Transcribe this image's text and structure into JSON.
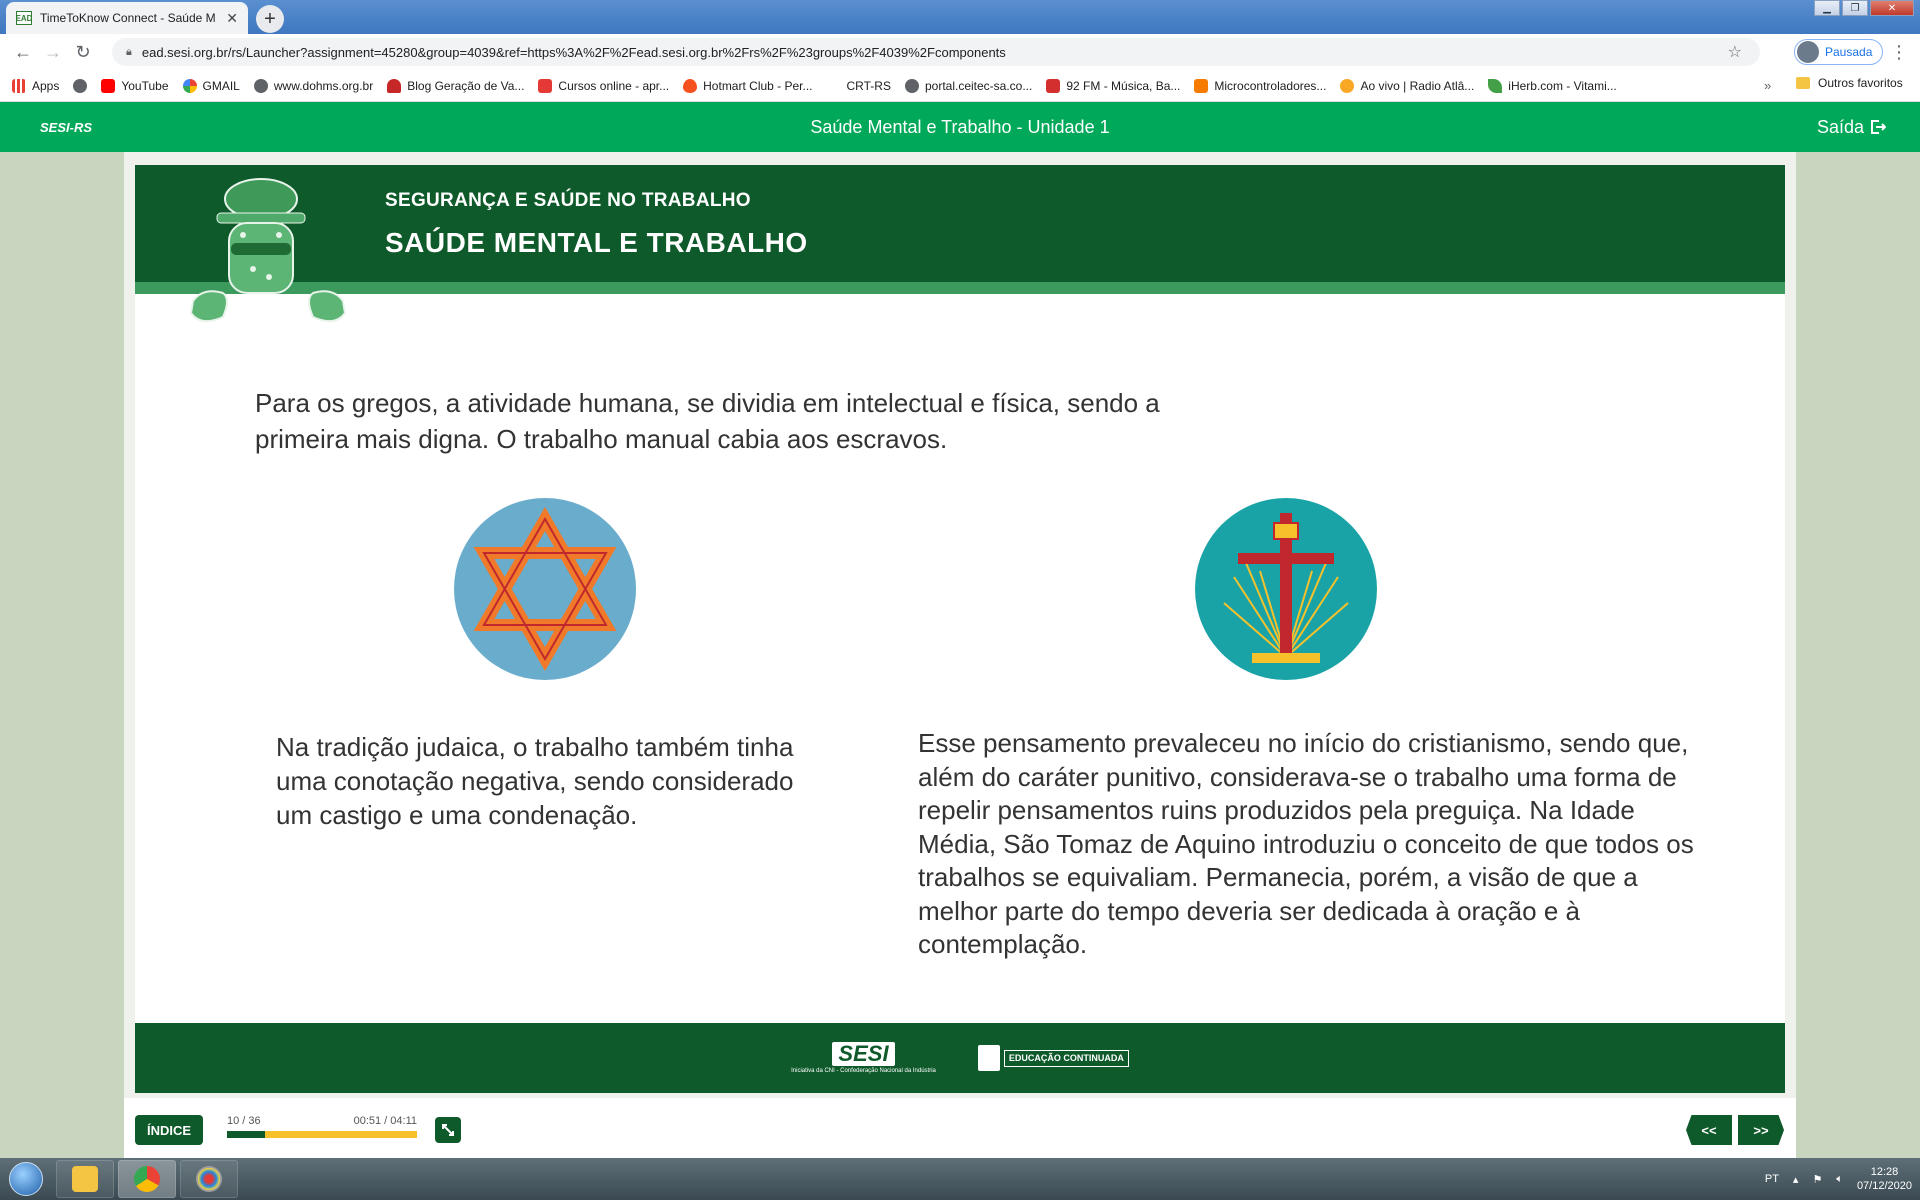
{
  "browser": {
    "tab_title": "TimeToKnow Connect - Saúde M",
    "tab_favicon": "EAD",
    "url": "ead.sesi.org.br/rs/Launcher?assignment=45280&group=4039&ref=https%3A%2F%2Fead.sesi.org.br%2Frs%2F%23groups%2F4039%2Fcomponents",
    "profile_label": "Pausada",
    "bookmarks": [
      {
        "label": "Apps",
        "icon": "apps-grid-icon",
        "color": "#e94235"
      },
      {
        "label": "",
        "icon": "globe-icon",
        "color": "#5f6368"
      },
      {
        "label": "YouTube",
        "icon": "youtube-icon",
        "color": "#ff0000"
      },
      {
        "label": "GMAIL",
        "icon": "google-icon",
        "color": "#4285f4"
      },
      {
        "label": "www.dohms.org.br",
        "icon": "globe-icon",
        "color": "#5f6368"
      },
      {
        "label": "Blog Geração de Va...",
        "icon": "club-icon",
        "color": "#c62828"
      },
      {
        "label": "Cursos online - apr...",
        "icon": "udemy-icon",
        "color": "#e53935"
      },
      {
        "label": "Hotmart Club - Per...",
        "icon": "flame-icon",
        "color": "#f4511e"
      },
      {
        "label": "CRT-RS",
        "icon": "blank-icon",
        "color": "#ffffff"
      },
      {
        "label": "portal.ceitec-sa.co...",
        "icon": "globe-icon",
        "color": "#5f6368"
      },
      {
        "label": "92 FM - Música, Ba...",
        "icon": "radio-92-icon",
        "color": "#d32f2f"
      },
      {
        "label": "Microcontroladores...",
        "icon": "blogger-icon",
        "color": "#f57c00"
      },
      {
        "label": "Ao vivo | Radio Atlâ...",
        "icon": "radio-icon",
        "color": "#f9a825"
      },
      {
        "label": "iHerb.com - Vitami...",
        "icon": "leaf-icon",
        "color": "#43a047"
      }
    ],
    "other_bookmarks": "Outros favoritos",
    "more": "»"
  },
  "app": {
    "brand": "SESI-RS",
    "title": "Saúde Mental e Trabalho - Unidade 1",
    "exit_label": "Saída"
  },
  "slide": {
    "kicker": "SEGURANÇA E SAÚDE NO TRABALHO",
    "heading": "SAÚDE MENTAL E TRABALHO",
    "intro": "Para os gregos, a atividade humana, se dividia em intelectual e física, sendo a primeira mais digna. O trabalho manual cabia aos escravos.",
    "left_text": "Na tradição judaica, o trabalho também tinha uma conotação negativa, sendo considerado um castigo e uma condenação.",
    "right_text": "Esse pensamento prevaleceu no início do cristianismo, sendo que, além do caráter punitivo, considerava-se o trabalho uma forma de repelir pensamentos ruins produzidos pela preguiça. Na Idade Média, São Tomaz de Aquino introduziu o conceito de que todos os trabalhos se equivaliam. Permanecia, porém, a visão de que a melhor parte do tempo deveria ser dedicada à oração e à contemplação.",
    "footer_logo_sesi": "SESI",
    "footer_logo_sesi_caption": "Iniciativa da CNI - Confederação Nacional da Indústria",
    "footer_logo_edu": "EDUCAÇÃO CONTINUADA"
  },
  "player": {
    "index_label": "ÍNDICE",
    "page_counter": "10 / 36",
    "time": "00:51 / 04:11",
    "progress": 0.2,
    "prev_label": "<<",
    "next_label": ">>"
  },
  "taskbar": {
    "lang": "PT",
    "time": "12:28",
    "date": "07/12/2020"
  },
  "colors": {
    "header_green": "#00a859",
    "dark_green": "#0e5a2a",
    "accent_yellow": "#f6c12b",
    "star_orange": "#f07a2a",
    "circle_blue": "#6aaccc",
    "circle_teal": "#1aa3a6",
    "cross_red": "#c0282d"
  }
}
